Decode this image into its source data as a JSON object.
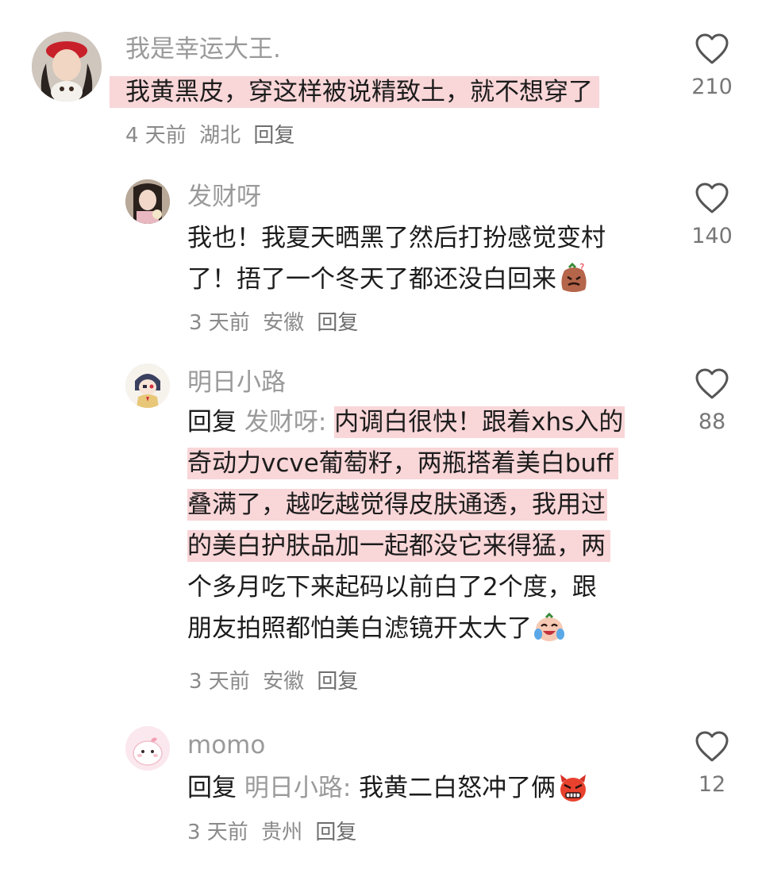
{
  "comments": [
    {
      "username": "我是幸运大王.",
      "lines": [
        "我黄黑皮，穿这样被说精致土，就不想穿了"
      ],
      "time": "4 天前",
      "location": "湖北",
      "reply_label": "回复",
      "likes": "210",
      "avatar_icon": "user-photo-avatar"
    },
    {
      "username": "发财呀",
      "lines": [
        "我也！我夏天晒黑了然后打扮感觉变村",
        "了！捂了一个冬天了都还没白回来"
      ],
      "emoji": "sweat-face-emoji",
      "time": "3 天前",
      "location": "安徽",
      "reply_label": "回复",
      "likes": "140",
      "avatar_icon": "user-photo-avatar"
    },
    {
      "username": "明日小路",
      "reply_prefix": "回复",
      "reply_target": "发财呀:",
      "lines_first": "内调白很快！跟着xhs入的",
      "lines": [
        "奇动力vcve葡萄籽，两瓶搭着美白buff",
        "叠满了，越吃越觉得皮肤通透，我用过",
        "的美白护肤品加一起都没它来得猛，两",
        "个多月吃下来起码以前白了2个度，跟",
        "朋友拍照都怕美白滤镜开太大了"
      ],
      "emoji": "crying-laugh-emoji",
      "time": "3 天前",
      "location": "安徽",
      "reply_label": "回复",
      "likes": "88",
      "avatar_icon": "anime-avatar"
    },
    {
      "username": "momo",
      "reply_prefix": "回复",
      "reply_target": "明日小路:",
      "lines": [
        "我黄二白怒冲了俩"
      ],
      "emoji": "angry-devil-emoji",
      "time": "3 天前",
      "location": "贵州",
      "reply_label": "回复",
      "likes": "12",
      "avatar_icon": "cute-animal-avatar"
    }
  ],
  "colors": {
    "highlight": "#f9d6d8",
    "username": "#9a9a9a",
    "text": "#1c1c1c",
    "meta": "#8a8a8a"
  },
  "icons": {
    "like": "heart-outline-icon"
  }
}
